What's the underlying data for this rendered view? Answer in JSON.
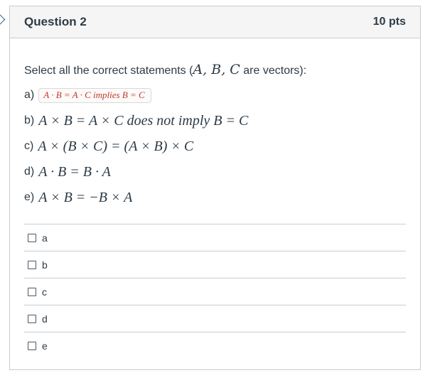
{
  "question": {
    "title": "Question 2",
    "points": "10 pts",
    "prompt_before": "Select all the correct statements (",
    "prompt_math": "A,  B,  C",
    "prompt_after": " are vectors):"
  },
  "statements": [
    {
      "letter": "a)",
      "math": "A · B  =  A · C implies B = C",
      "highlighted": true
    },
    {
      "letter": "b)",
      "math": "A × B  = A × C does not imply B = C",
      "highlighted": false
    },
    {
      "letter": "c)",
      "math": "A × (B × C) = (A × B) × C",
      "highlighted": false
    },
    {
      "letter": "d)",
      "math": "A · B = B · A",
      "highlighted": false
    },
    {
      "letter": "e)",
      "math": "A × B = −B × A",
      "highlighted": false
    }
  ],
  "answers": [
    {
      "label": "a",
      "checked": false
    },
    {
      "label": "b",
      "checked": false
    },
    {
      "label": "c",
      "checked": false
    },
    {
      "label": "d",
      "checked": false
    },
    {
      "label": "e",
      "checked": false
    }
  ],
  "colors": {
    "highlight_text": "#c0392b",
    "border": "#c7cdd1",
    "header_bg": "#f5f5f5"
  }
}
